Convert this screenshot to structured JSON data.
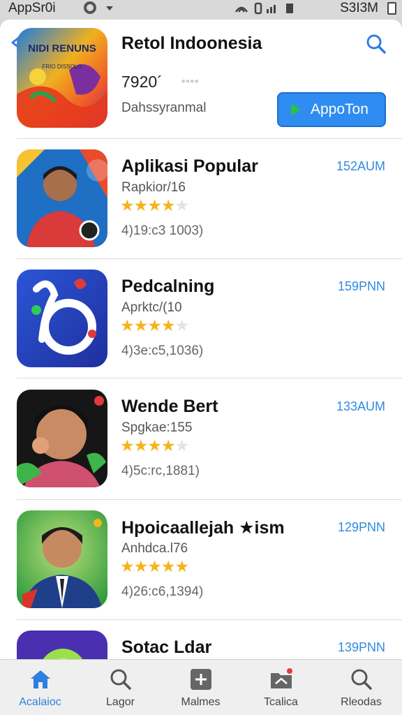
{
  "status_bar": {
    "left_text": "AppSr0i",
    "right_text": "S3I3M"
  },
  "header": {
    "app_title": "Retol Indoonesia",
    "count": "7920´",
    "dots": "◦◦◦◦",
    "developer": "Dahssyranmal",
    "get_button_label": "AppoTon",
    "hero_logo_text": "NIDI RENUNS",
    "hero_logo_sub": "FRIO DISSOLO"
  },
  "list": [
    {
      "title": "Aplikasi Popular",
      "subtitle": "Rapkior/16",
      "rating": 4,
      "size": "4)19:c3 1003)",
      "time": "152AUM"
    },
    {
      "title": "Pedcalning",
      "subtitle": "Aprktc/(10",
      "rating": 4,
      "size": "4)3e:c5,1036)",
      "time": "159PNN"
    },
    {
      "title": "Wende Bert",
      "subtitle": "Spgkae:155",
      "rating": 4,
      "size": "4)5c:rc,1881)",
      "time": "133AUM"
    },
    {
      "title": "Hpoicaallejah ★ism",
      "subtitle": "Anhdca.l76",
      "rating": 5,
      "size": "4)26:c6,1394)",
      "time": "129PNN"
    },
    {
      "title": "Sotac Ldar",
      "subtitle": "",
      "rating": 0,
      "size": "",
      "time": "139PNN"
    }
  ],
  "bottom_nav": [
    {
      "label": "Acalaioc",
      "icon": "home-icon"
    },
    {
      "label": "Lagor",
      "icon": "search-icon"
    },
    {
      "label": "Malmes",
      "icon": "add-icon"
    },
    {
      "label": "Tcalica",
      "icon": "folder-icon"
    },
    {
      "label": "Rleodas",
      "icon": "search-icon"
    }
  ],
  "colors": {
    "accent": "#2f8ae0",
    "button": "#2f8cf0",
    "star": "#f4b41a"
  }
}
